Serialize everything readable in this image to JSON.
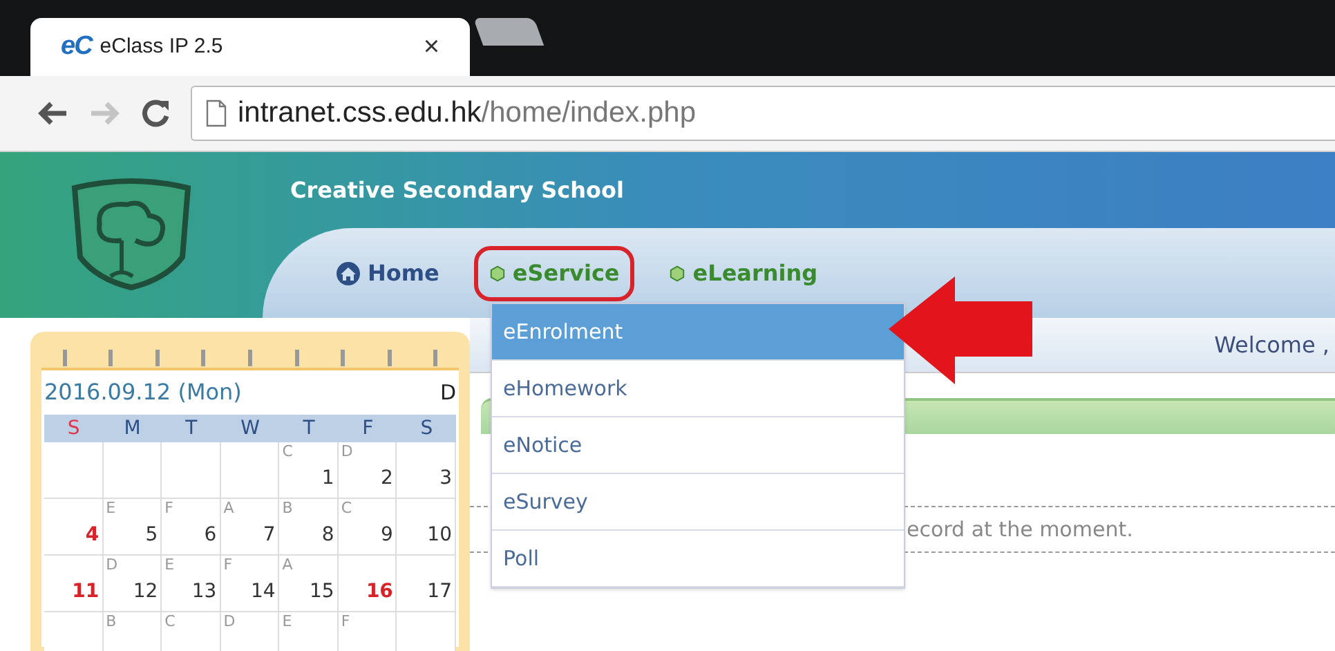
{
  "browser": {
    "tabs": [
      {
        "favicon_text": "eC",
        "title": "eClass IP 2.5",
        "close": "×",
        "selected": true
      },
      {
        "selected": false
      }
    ],
    "address": {
      "host": "intranet.css.edu.hk",
      "path": "/home/index.php"
    }
  },
  "header": {
    "school_name": "Creative Secondary School",
    "nav": [
      {
        "label": "Home",
        "kind": "home",
        "highlighted": false
      },
      {
        "label": "eService",
        "kind": "module",
        "highlighted": true
      },
      {
        "label": "eLearning",
        "kind": "module",
        "highlighted": false
      }
    ]
  },
  "menu": [
    {
      "label": "eEnrolment",
      "selected": true
    },
    {
      "label": "eHomework",
      "selected": false
    },
    {
      "label": "eNotice",
      "selected": false
    },
    {
      "label": "eSurvey",
      "selected": false
    },
    {
      "label": "Poll",
      "selected": false
    }
  ],
  "welcome": "Welcome ,",
  "calendar": {
    "date_label": "2016.09.12 (Mon)",
    "view_label": "D",
    "weekdays": [
      "S",
      "M",
      "T",
      "W",
      "T",
      "F",
      "S"
    ],
    "weeks": [
      [
        {
          "kind": "blank"
        },
        {
          "kind": "blank"
        },
        {
          "kind": "blank"
        },
        {
          "kind": "blank"
        },
        {
          "kind": "date",
          "letter": "C",
          "day": "1",
          "holiday": false
        },
        {
          "kind": "date",
          "letter": "D",
          "day": "2",
          "holiday": false
        },
        {
          "kind": "date",
          "day": "3",
          "holiday": false
        }
      ],
      [
        {
          "kind": "date",
          "day": "4",
          "holiday": true
        },
        {
          "kind": "date",
          "letter": "E",
          "day": "5",
          "holiday": false
        },
        {
          "kind": "date",
          "letter": "F",
          "day": "6",
          "holiday": false
        },
        {
          "kind": "date",
          "letter": "A",
          "day": "7",
          "holiday": false
        },
        {
          "kind": "date",
          "letter": "B",
          "day": "8",
          "holiday": false
        },
        {
          "kind": "date",
          "letter": "C",
          "day": "9",
          "holiday": false
        },
        {
          "kind": "date",
          "day": "10",
          "holiday": false
        }
      ],
      [
        {
          "kind": "date",
          "day": "11",
          "holiday": true
        },
        {
          "kind": "date",
          "letter": "D",
          "day": "12",
          "holiday": false
        },
        {
          "kind": "date",
          "letter": "E",
          "day": "13",
          "holiday": false
        },
        {
          "kind": "date",
          "letter": "F",
          "day": "14",
          "holiday": false
        },
        {
          "kind": "date",
          "letter": "A",
          "day": "15",
          "holiday": false
        },
        {
          "kind": "date",
          "day": "16",
          "holiday": true
        },
        {
          "kind": "date",
          "day": "17",
          "holiday": false
        }
      ],
      [
        {
          "kind": "blank"
        },
        {
          "kind": "date",
          "letter": "B"
        },
        {
          "kind": "date",
          "letter": "C"
        },
        {
          "kind": "date",
          "letter": "D"
        },
        {
          "kind": "date",
          "letter": "E"
        },
        {
          "kind": "date",
          "letter": "F"
        },
        {
          "kind": "blank"
        }
      ]
    ]
  },
  "notice": "ecord at the moment."
}
